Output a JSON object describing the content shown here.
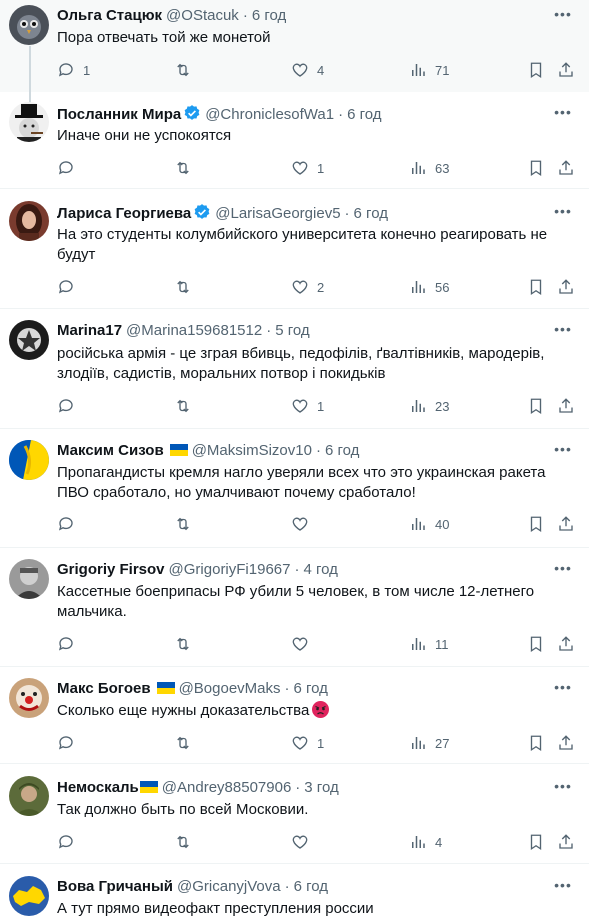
{
  "tweets": [
    {
      "name": "Ольга Стацюк",
      "handle": "@OStacuk",
      "time": "6 год",
      "text": "Пора отвечать той же монетой",
      "replies": "1",
      "likes": "4",
      "views": "71",
      "verified": false,
      "flag": false,
      "avatar_icon": "owl-avatar-icon",
      "avatar_color": "#4a5058"
    },
    {
      "name": "Посланник Мира",
      "handle": "@ChroniclesofWa1",
      "time": "6 год",
      "text": "Иначе они не успокоятся",
      "replies": "",
      "likes": "1",
      "views": "63",
      "verified": true,
      "flag": false,
      "avatar_icon": "churchill-avatar-icon",
      "avatar_color": "#222222"
    },
    {
      "name": "Лариса Георгиева",
      "handle": "@LarisaGeorgiev5",
      "time": "6 год",
      "text": "На это студенты колумбийского университета конечно реагировать не будут",
      "replies": "",
      "likes": "2",
      "views": "56",
      "verified": true,
      "flag": false,
      "avatar_icon": "woman-avatar-icon",
      "avatar_color": "#7a3b2e"
    },
    {
      "name": "Marina17",
      "handle": "@Marina159681512",
      "time": "5 год",
      "text": "російська армія - це зграя вбивць, педофілів, ґвалтівників, мародерів, злодіїв, садистів, моральних потвор і покидьків",
      "replies": "",
      "likes": "1",
      "views": "23",
      "verified": false,
      "flag": false,
      "avatar_icon": "emblem-avatar-icon",
      "avatar_color": "#1c1c1c"
    },
    {
      "name": "Максим Сизов",
      "handle": "@MaksimSizov10",
      "time": "6 год",
      "text": "Пропагандисты кремля нагло уверяли всех что это украинская ракета ПВО сработало, но умалчивают почему сработало!",
      "replies": "",
      "likes": "",
      "views": "40",
      "verified": false,
      "flag": true,
      "avatar_icon": "ukraine-flag-avatar-icon",
      "avatar_color": "#0057b7"
    },
    {
      "name": "Grigoriy Firsov",
      "handle": "@GrigoriyFi19667",
      "time": "4 год",
      "text": "Кассетные боеприпасы РФ  убили 5 человек, в том числе 12-летнего мальчика.",
      "replies": "",
      "likes": "",
      "views": "11",
      "verified": false,
      "flag": false,
      "avatar_icon": "man-avatar-icon",
      "avatar_color": "#6b6b6b"
    },
    {
      "name": "Макс Богоев",
      "handle": "@BogoevMaks",
      "time": "6 год",
      "text": "Сколько еще нужны доказательства",
      "emoji": "angry-face-emoji",
      "replies": "",
      "likes": "1",
      "views": "27",
      "verified": false,
      "flag": true,
      "avatar_icon": "clown-avatar-icon",
      "avatar_color": "#c9a27a"
    },
    {
      "name": "Немоскаль",
      "handle": "@Andrey88507906",
      "time": "3 год",
      "text": "Так должно быть по всей Московии.",
      "replies": "",
      "likes": "",
      "views": "4",
      "verified": false,
      "flag": true,
      "avatar_icon": "soldier-avatar-icon",
      "avatar_color": "#5c6b3a"
    },
    {
      "name": "Вова Гричаный",
      "handle": "@GricanyjVova",
      "time": "6 год",
      "text": "А тут прямо видеофакт преступления россии",
      "replies": "",
      "likes": "",
      "views": "",
      "verified": false,
      "flag": false,
      "avatar_icon": "map-avatar-icon",
      "avatar_color": "#2a5caa"
    }
  ],
  "colors": {
    "muted": "#536471",
    "verified": "#1d9bf0",
    "divider": "#eff3f4"
  }
}
